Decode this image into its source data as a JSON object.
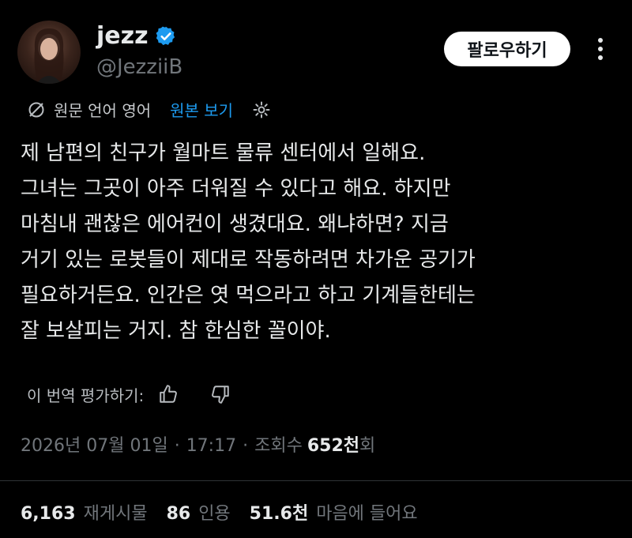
{
  "author": {
    "name": "jezz",
    "handle": "@JezziiB"
  },
  "follow_label": "팔로우하기",
  "translation": {
    "lang_text": "원문 언어 영어",
    "view_original": "원본 보기"
  },
  "post_lines": [
    "제 남편의 친구가 월마트 물류 센터에서 일해요.",
    "그녀는 그곳이 아주 더워질 수 있다고 해요. 하지만",
    "마침내 괜찮은 에어컨이 생겼대요. 왜냐하면? 지금",
    "거기 있는 로봇들이 제대로 작동하려면 차가운 공기가",
    "필요하거든요. 인간은 엿 먹으라고 하고 기계들한테는",
    "잘 보살피는 거지. 참 한심한 꼴이야."
  ],
  "rate_label": "이 번역 평가하기:",
  "meta": {
    "date": "2026년 07월 01일",
    "sep1": "·",
    "time": "17:17",
    "sep2": "·",
    "views_label": "조회수",
    "views_value": "652천",
    "views_suffix": "회"
  },
  "stats": {
    "reposts_value": "6,163",
    "reposts_label": "재게시물",
    "quotes_value": "86",
    "quotes_label": "인용",
    "likes_value": "51.6천",
    "likes_label": "마음에 들어요"
  },
  "icons": {
    "verified": "verified-badge-icon",
    "translate": "translate-icon",
    "settings": "gear-icon",
    "thumbs_up": "thumbs-up-icon",
    "thumbs_down": "thumbs-down-icon",
    "more": "more-icon"
  },
  "colors": {
    "background": "#000000",
    "text": "#e7e9ea",
    "muted": "#71767b",
    "link": "#1d9bf0",
    "verified": "#1d9bf0"
  }
}
